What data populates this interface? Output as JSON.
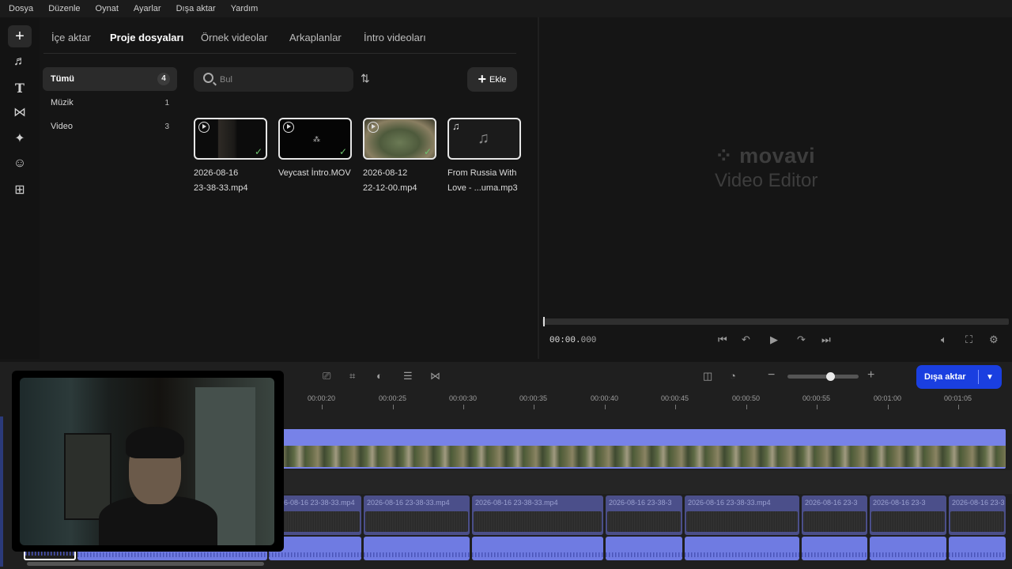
{
  "menu": [
    "Dosya",
    "Düzenle",
    "Oynat",
    "Ayarlar",
    "Dışa aktar",
    "Yardım"
  ],
  "sidebar_icons": [
    "plus-icon",
    "music-note-icon",
    "text-icon",
    "transition-icon",
    "magic-wand-icon",
    "sticker-icon",
    "more-tools-icon"
  ],
  "tabs": [
    {
      "label": "İçe aktar",
      "active": false
    },
    {
      "label": "Proje dosyaları",
      "active": true
    },
    {
      "label": "Örnek videolar",
      "active": false
    },
    {
      "label": "Arkaplanlar",
      "active": false
    },
    {
      "label": "İntro videoları",
      "active": false
    }
  ],
  "categories": [
    {
      "label": "Tümü",
      "count": "4",
      "active": true
    },
    {
      "label": "Müzik",
      "count": "1",
      "active": false
    },
    {
      "label": "Video",
      "count": "3",
      "active": false
    }
  ],
  "search": {
    "placeholder": "Bul"
  },
  "add_button": {
    "label": "Ekle"
  },
  "media": [
    {
      "name": "2026-08-16\n23-38-33.mp4",
      "type": "video",
      "added": true
    },
    {
      "name": "Veycast İntro.MOV",
      "type": "video",
      "added": true
    },
    {
      "name": "2026-08-12\n22-12-00.mp4",
      "type": "video",
      "added": true
    },
    {
      "name": "From Russia With\nLove - ...uma.mp3",
      "type": "audio",
      "added": false
    }
  ],
  "preview": {
    "logo_line1": "movavi",
    "logo_line2": "Video Editor",
    "timecode_main": "00:00.",
    "timecode_ms": "000"
  },
  "export": {
    "label": "Dışa aktar",
    "color": "#1a3fe0"
  },
  "ruler": [
    "00:00:20",
    "00:00:25",
    "00:00:30",
    "00:00:35",
    "00:00:40",
    "00:00:45",
    "00:00:50",
    "00:00:55",
    "00:01:00",
    "00:01:05"
  ],
  "clips": [
    {
      "name": "2026-08-16 23-38-33.mp4"
    },
    {
      "name": "2026-08-16 23-38-33.mp4"
    },
    {
      "name": "2026-08-16 23-38-33.mp4"
    },
    {
      "name": "2026-08-16 23-38-3"
    },
    {
      "name": "2026-08-16 23-38-33.mp4"
    },
    {
      "name": "2026-08-16 23-3"
    },
    {
      "name": "2026-08-16 23-3"
    },
    {
      "name": "2026-08-16 23-3"
    }
  ],
  "colors": {
    "accent": "#1a3fe0",
    "track": "#7782e8",
    "clip": "#4b4f8a"
  }
}
